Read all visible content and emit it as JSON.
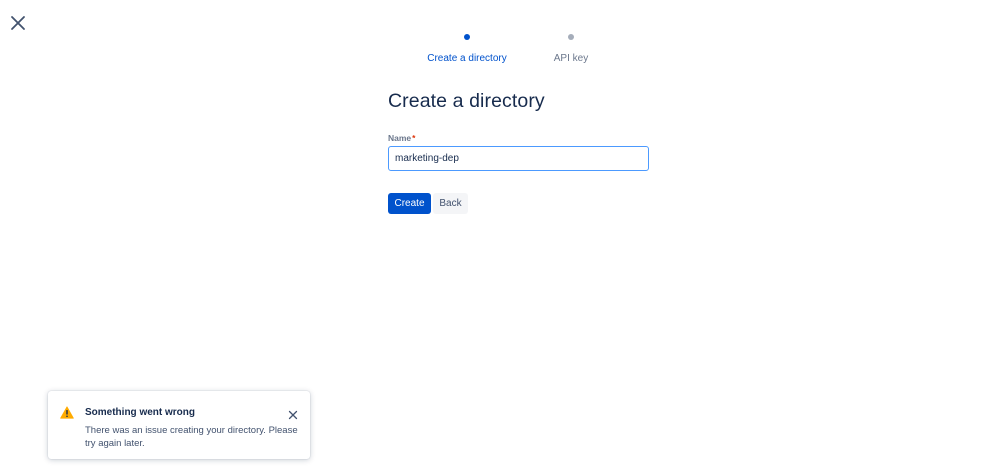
{
  "close": {
    "icon": "close-icon"
  },
  "stepper": {
    "steps": [
      {
        "label": "Create a directory",
        "state": "active",
        "color": "#0052cc"
      },
      {
        "label": "API key",
        "state": "upcoming",
        "color": "#a5adba"
      }
    ]
  },
  "form": {
    "title": "Create a directory",
    "name_label": "Name",
    "required_marker": "*",
    "name_value": "marketing-dep",
    "create_label": "Create",
    "back_label": "Back"
  },
  "flag": {
    "icon": "warning-icon",
    "icon_color": "#ffab00",
    "title": "Something went wrong",
    "body": "There was an issue creating your directory. Please try again later."
  },
  "colors": {
    "primary": "#0052cc",
    "focus_border": "#4c9aff",
    "text": "#172b4d"
  }
}
